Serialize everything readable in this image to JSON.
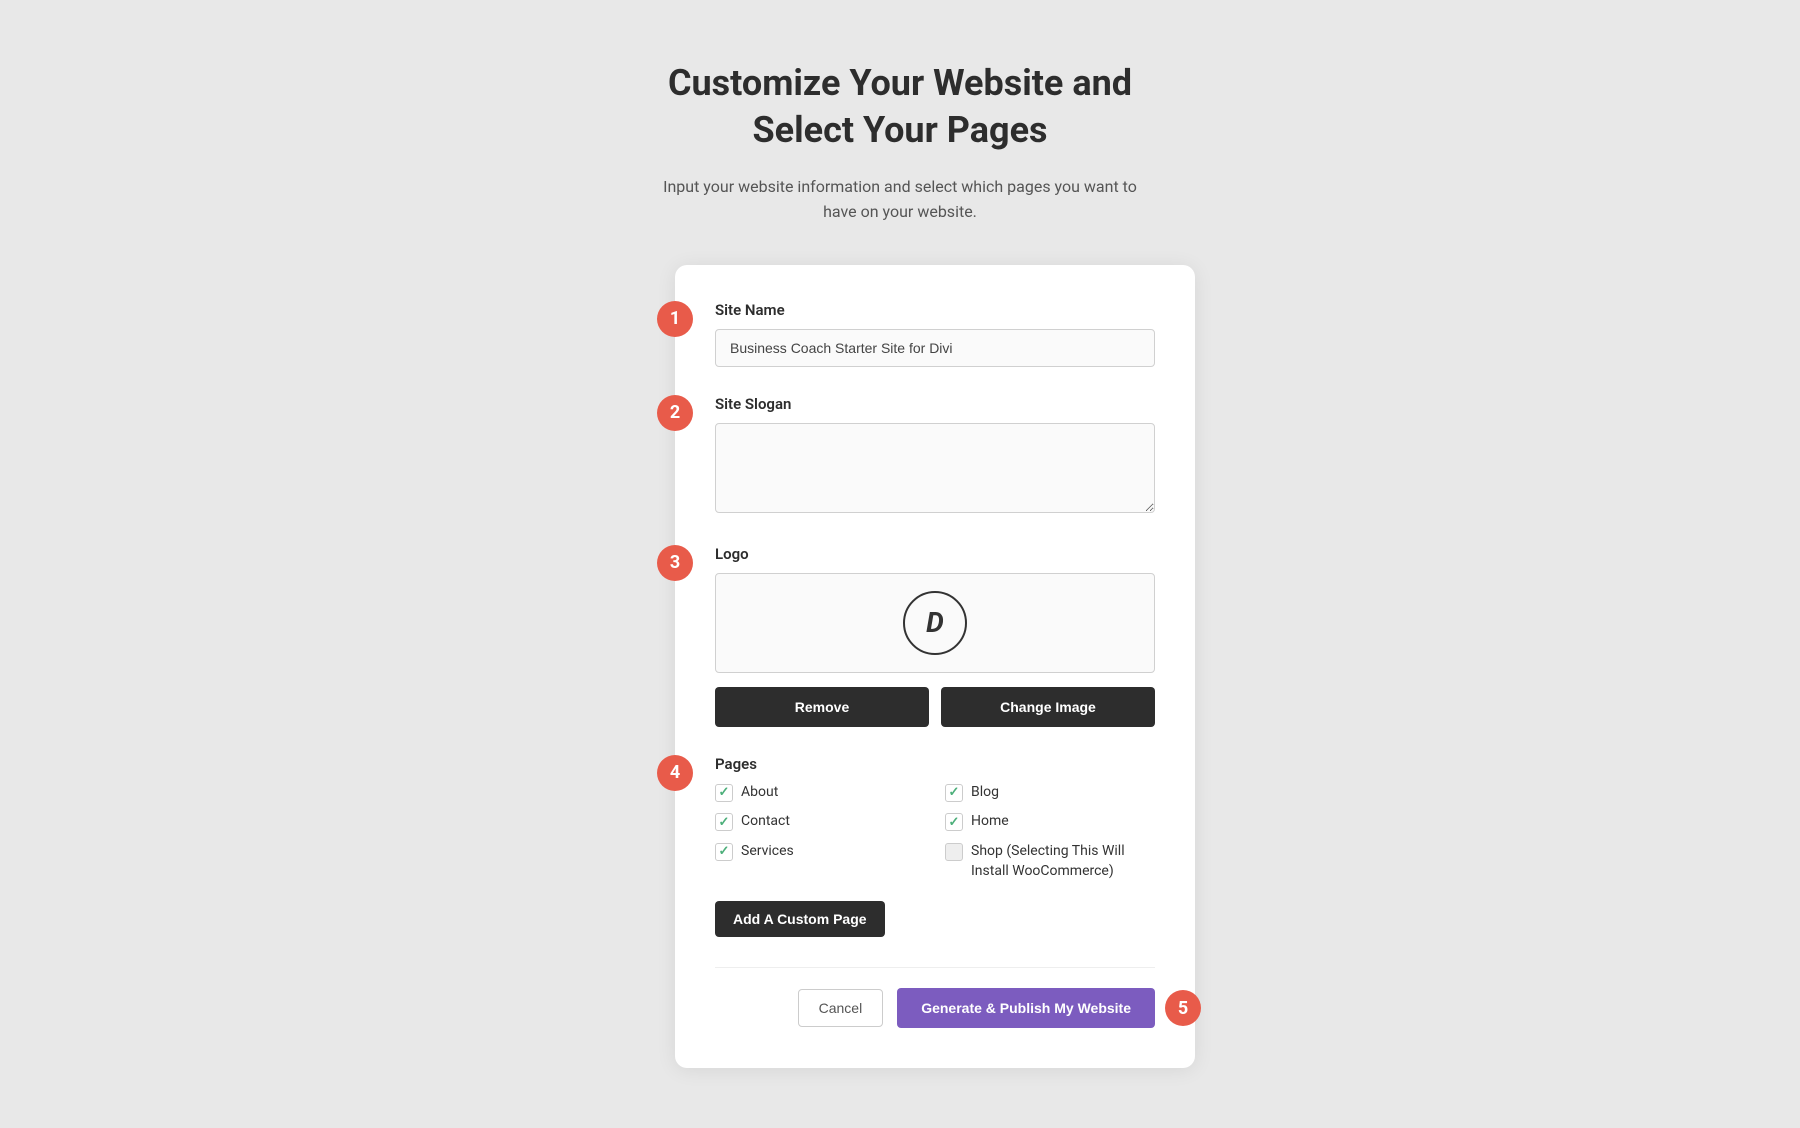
{
  "header": {
    "title_line1": "Customize Your Website and",
    "title_line2": "Select Your Pages",
    "subtitle": "Input your website information and select which pages you want to have on your website."
  },
  "steps": {
    "step1": {
      "badge": "1",
      "label": "Site Name",
      "value": "Business Coach Starter Site for Divi",
      "placeholder": "Business Coach Starter Site for Divi"
    },
    "step2": {
      "badge": "2",
      "label": "Site Slogan",
      "value": "",
      "placeholder": ""
    },
    "step3": {
      "badge": "3",
      "label": "Logo",
      "logo_icon_text": "D"
    },
    "step4": {
      "badge": "4",
      "label": "Pages",
      "pages": [
        {
          "name": "About",
          "checked": true,
          "column": "left"
        },
        {
          "name": "Blog",
          "checked": true,
          "column": "right"
        },
        {
          "name": "Contact",
          "checked": true,
          "column": "left"
        },
        {
          "name": "Home",
          "checked": true,
          "column": "right"
        },
        {
          "name": "Services",
          "checked": true,
          "column": "left"
        },
        {
          "name": "Shop (Selecting This Will Install WooCommerce)",
          "checked": false,
          "column": "right"
        }
      ]
    }
  },
  "buttons": {
    "remove": "Remove",
    "change_image": "Change Image",
    "add_custom_page": "Add A Custom Page",
    "cancel": "Cancel",
    "generate_publish": "Generate & Publish My Website"
  },
  "step5_badge": "5"
}
